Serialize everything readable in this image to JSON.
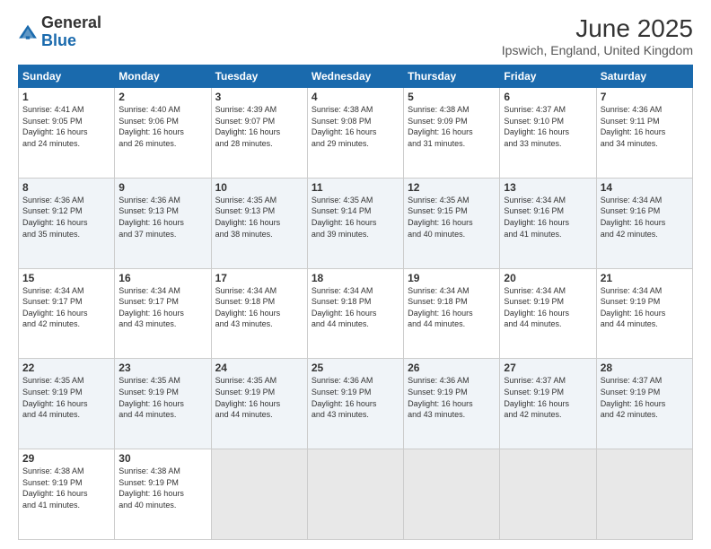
{
  "header": {
    "logo_general": "General",
    "logo_blue": "Blue",
    "title": "June 2025",
    "subtitle": "Ipswich, England, United Kingdom"
  },
  "days_of_week": [
    "Sunday",
    "Monday",
    "Tuesday",
    "Wednesday",
    "Thursday",
    "Friday",
    "Saturday"
  ],
  "weeks": [
    [
      {
        "day": "1",
        "info": "Sunrise: 4:41 AM\nSunset: 9:05 PM\nDaylight: 16 hours\nand 24 minutes."
      },
      {
        "day": "2",
        "info": "Sunrise: 4:40 AM\nSunset: 9:06 PM\nDaylight: 16 hours\nand 26 minutes."
      },
      {
        "day": "3",
        "info": "Sunrise: 4:39 AM\nSunset: 9:07 PM\nDaylight: 16 hours\nand 28 minutes."
      },
      {
        "day": "4",
        "info": "Sunrise: 4:38 AM\nSunset: 9:08 PM\nDaylight: 16 hours\nand 29 minutes."
      },
      {
        "day": "5",
        "info": "Sunrise: 4:38 AM\nSunset: 9:09 PM\nDaylight: 16 hours\nand 31 minutes."
      },
      {
        "day": "6",
        "info": "Sunrise: 4:37 AM\nSunset: 9:10 PM\nDaylight: 16 hours\nand 33 minutes."
      },
      {
        "day": "7",
        "info": "Sunrise: 4:36 AM\nSunset: 9:11 PM\nDaylight: 16 hours\nand 34 minutes."
      }
    ],
    [
      {
        "day": "8",
        "info": "Sunrise: 4:36 AM\nSunset: 9:12 PM\nDaylight: 16 hours\nand 35 minutes."
      },
      {
        "day": "9",
        "info": "Sunrise: 4:36 AM\nSunset: 9:13 PM\nDaylight: 16 hours\nand 37 minutes."
      },
      {
        "day": "10",
        "info": "Sunrise: 4:35 AM\nSunset: 9:13 PM\nDaylight: 16 hours\nand 38 minutes."
      },
      {
        "day": "11",
        "info": "Sunrise: 4:35 AM\nSunset: 9:14 PM\nDaylight: 16 hours\nand 39 minutes."
      },
      {
        "day": "12",
        "info": "Sunrise: 4:35 AM\nSunset: 9:15 PM\nDaylight: 16 hours\nand 40 minutes."
      },
      {
        "day": "13",
        "info": "Sunrise: 4:34 AM\nSunset: 9:16 PM\nDaylight: 16 hours\nand 41 minutes."
      },
      {
        "day": "14",
        "info": "Sunrise: 4:34 AM\nSunset: 9:16 PM\nDaylight: 16 hours\nand 42 minutes."
      }
    ],
    [
      {
        "day": "15",
        "info": "Sunrise: 4:34 AM\nSunset: 9:17 PM\nDaylight: 16 hours\nand 42 minutes."
      },
      {
        "day": "16",
        "info": "Sunrise: 4:34 AM\nSunset: 9:17 PM\nDaylight: 16 hours\nand 43 minutes."
      },
      {
        "day": "17",
        "info": "Sunrise: 4:34 AM\nSunset: 9:18 PM\nDaylight: 16 hours\nand 43 minutes."
      },
      {
        "day": "18",
        "info": "Sunrise: 4:34 AM\nSunset: 9:18 PM\nDaylight: 16 hours\nand 44 minutes."
      },
      {
        "day": "19",
        "info": "Sunrise: 4:34 AM\nSunset: 9:18 PM\nDaylight: 16 hours\nand 44 minutes."
      },
      {
        "day": "20",
        "info": "Sunrise: 4:34 AM\nSunset: 9:19 PM\nDaylight: 16 hours\nand 44 minutes."
      },
      {
        "day": "21",
        "info": "Sunrise: 4:34 AM\nSunset: 9:19 PM\nDaylight: 16 hours\nand 44 minutes."
      }
    ],
    [
      {
        "day": "22",
        "info": "Sunrise: 4:35 AM\nSunset: 9:19 PM\nDaylight: 16 hours\nand 44 minutes."
      },
      {
        "day": "23",
        "info": "Sunrise: 4:35 AM\nSunset: 9:19 PM\nDaylight: 16 hours\nand 44 minutes."
      },
      {
        "day": "24",
        "info": "Sunrise: 4:35 AM\nSunset: 9:19 PM\nDaylight: 16 hours\nand 44 minutes."
      },
      {
        "day": "25",
        "info": "Sunrise: 4:36 AM\nSunset: 9:19 PM\nDaylight: 16 hours\nand 43 minutes."
      },
      {
        "day": "26",
        "info": "Sunrise: 4:36 AM\nSunset: 9:19 PM\nDaylight: 16 hours\nand 43 minutes."
      },
      {
        "day": "27",
        "info": "Sunrise: 4:37 AM\nSunset: 9:19 PM\nDaylight: 16 hours\nand 42 minutes."
      },
      {
        "day": "28",
        "info": "Sunrise: 4:37 AM\nSunset: 9:19 PM\nDaylight: 16 hours\nand 42 minutes."
      }
    ],
    [
      {
        "day": "29",
        "info": "Sunrise: 4:38 AM\nSunset: 9:19 PM\nDaylight: 16 hours\nand 41 minutes."
      },
      {
        "day": "30",
        "info": "Sunrise: 4:38 AM\nSunset: 9:19 PM\nDaylight: 16 hours\nand 40 minutes."
      },
      {
        "day": "",
        "info": ""
      },
      {
        "day": "",
        "info": ""
      },
      {
        "day": "",
        "info": ""
      },
      {
        "day": "",
        "info": ""
      },
      {
        "day": "",
        "info": ""
      }
    ]
  ]
}
